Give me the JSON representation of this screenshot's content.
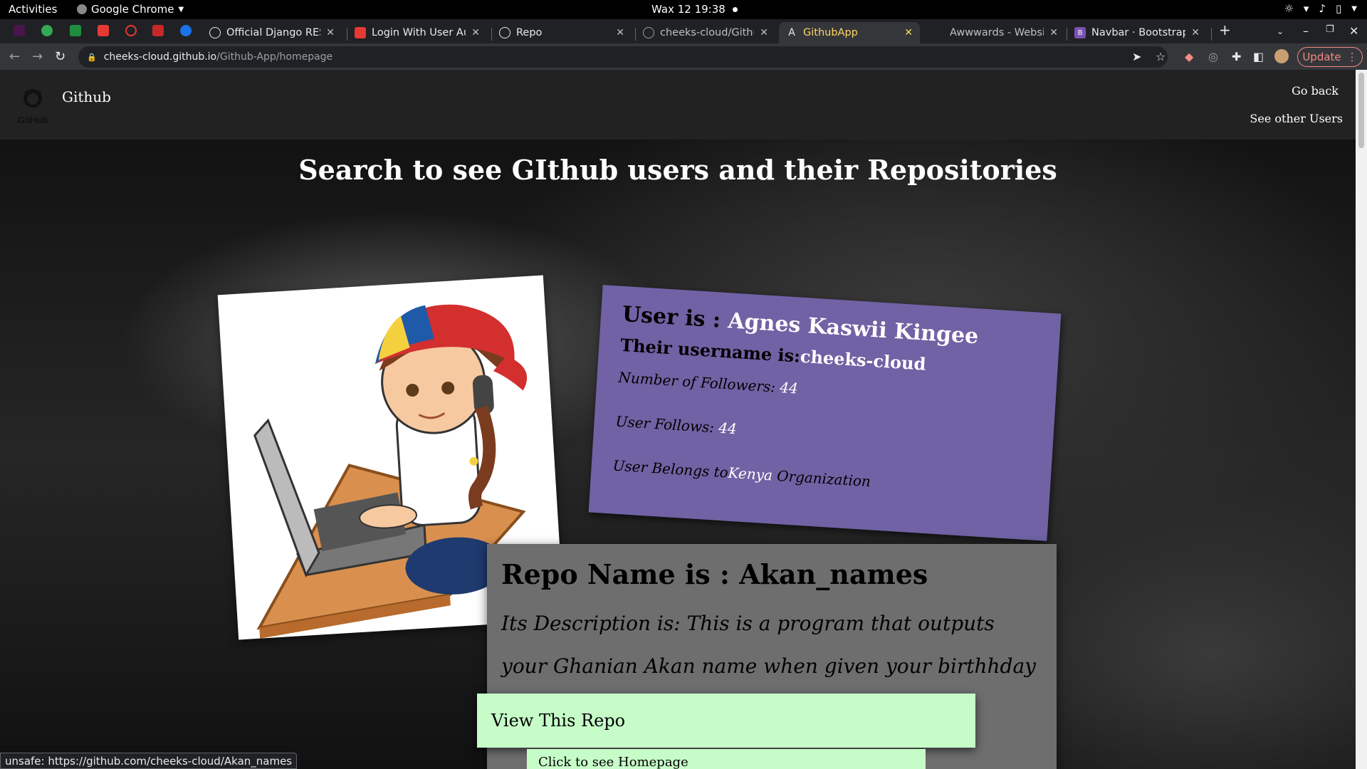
{
  "os_bar": {
    "activities": "Activities",
    "app_name": "Google Chrome",
    "clock": "Wax 12  19:38"
  },
  "tabs": [
    {
      "title": "Official Django REST",
      "favicon": "globe-icon"
    },
    {
      "title": "Login With User Aut",
      "favicon": "youtube-icon"
    },
    {
      "title": "Repo",
      "favicon": "globe-icon"
    },
    {
      "title": "cheeks-cloud/Githu",
      "favicon": "github-icon"
    },
    {
      "title": "GithubApp",
      "favicon": "angular-icon"
    },
    {
      "title": "Awwwards - Websit",
      "favicon": "awwwards-icon"
    },
    {
      "title": "Navbar · Bootstrap",
      "favicon": "bootstrap-icon"
    }
  ],
  "address": {
    "host": "cheeks-cloud.github.io",
    "path": "/Github-App/homepage"
  },
  "update_label": "Update",
  "navbar": {
    "brand": "Github",
    "logo_text": "GitHub",
    "go_back": "Go back",
    "see_others": "See other Users"
  },
  "headline": "Search to see GIthub users and their Repositories",
  "user_card": {
    "name_prefix": "User is : ",
    "name": "Agnes Kaswii Kingee",
    "username_prefix": "Their username is:",
    "username": "cheeks-cloud",
    "followers_prefix": "Number of Followers: ",
    "followers": "44",
    "follows_prefix": "User Follows: ",
    "follows": "44",
    "org_prefix": "User Belongs to",
    "org": "Kenya",
    "org_suffix": " Organization"
  },
  "repo": {
    "title": "Repo Name is : Akan_names",
    "description": "Its Description is: This is a program that outputs your Ghanian Akan name when given your birthhday",
    "view_button": "View This Repo",
    "home_button": "Click to see Homepage"
  },
  "status_url": "unsafe: https://github.com/cheeks-cloud/Akan_names",
  "colors": {
    "card_purple": "#7062a4",
    "button_green": "#c6fcc8",
    "repo_grey": "#6e6e6e"
  }
}
